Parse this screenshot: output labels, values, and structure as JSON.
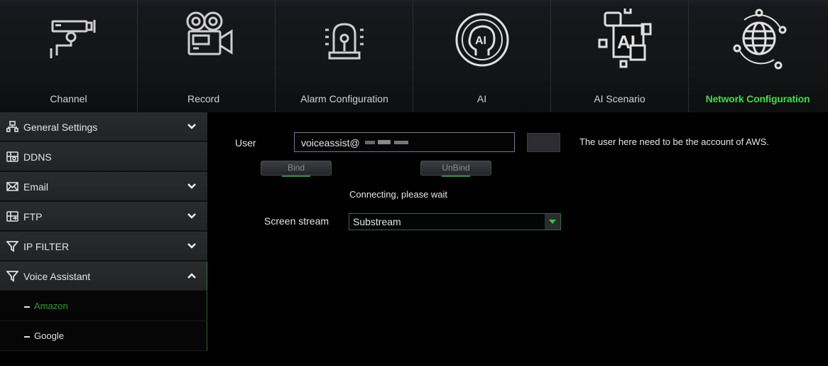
{
  "top_tabs": [
    {
      "label": "Channel",
      "icon": "camera-icon"
    },
    {
      "label": "Record",
      "icon": "video-recorder-icon"
    },
    {
      "label": "Alarm Configuration",
      "icon": "alarm-light-icon"
    },
    {
      "label": "AI",
      "icon": "ai-head-icon"
    },
    {
      "label": "AI Scenario",
      "icon": "ai-scenario-icon"
    },
    {
      "label": "Network Configuration",
      "icon": "globe-icon",
      "active": true
    }
  ],
  "sidebar": {
    "items": [
      {
        "label": "General Settings",
        "icon": "network-icon",
        "chevron": "down"
      },
      {
        "label": "DDNS",
        "icon": "ddns-icon"
      },
      {
        "label": "Email",
        "icon": "envelope-icon",
        "chevron": "down"
      },
      {
        "label": "FTP",
        "icon": "ftp-icon",
        "chevron": "down"
      },
      {
        "label": "IP FILTER",
        "icon": "filter-icon",
        "chevron": "down"
      },
      {
        "label": "Voice Assistant",
        "icon": "filter-icon",
        "chevron": "up"
      }
    ],
    "subitems": [
      {
        "label": "Amazon",
        "active": true
      },
      {
        "label": "Google"
      }
    ]
  },
  "form": {
    "user_label": "User",
    "user_value": "voiceassist@",
    "bind_label": "Bind",
    "unbind_label": "UnBind",
    "status": "Connecting, please wait",
    "stream_label": "Screen stream",
    "stream_value": "Substream",
    "note": "The user here need to be the account of AWS."
  },
  "colors": {
    "accent_green": "#47d74c",
    "active_subitem": "#2f9a33"
  }
}
